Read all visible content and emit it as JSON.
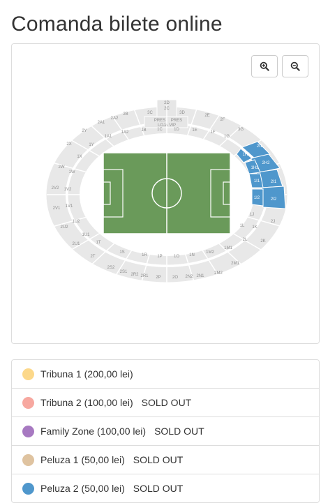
{
  "page": {
    "title": "Comanda bilete online"
  },
  "map": {
    "zoom_in_icon": "zoom-in-icon",
    "zoom_out_icon": "zoom-out-icon",
    "sections_grey": [
      "2D",
      "2C",
      "3D",
      "2B",
      "3C",
      "2E",
      "2A2",
      "1C",
      "1D",
      "2F",
      "2A1",
      "1B",
      "1E",
      "3G",
      "2Y",
      "1A2",
      "1F",
      "1A1",
      "1G",
      "2X",
      "1Y",
      "1X",
      "2W",
      "1W",
      "2V2",
      "1V2",
      "2V1",
      "1V1",
      "1U2",
      "2U2",
      "1U1",
      "2U1",
      "1T",
      "2T",
      "1S",
      "1R",
      "1P",
      "1O",
      "1N",
      "1M2",
      "1M1",
      "2S2",
      "2S1",
      "2R2",
      "2R1",
      "2P",
      "2O",
      "2N2",
      "2N1",
      "2M2",
      "2M1",
      "2L",
      "1L",
      "2K",
      "1K",
      "2J",
      "1J"
    ],
    "sections_blue": [
      "2I1",
      "1H1",
      "2H2",
      "1H2",
      "2I2",
      "1I1",
      "1I2"
    ],
    "press_labels": [
      "PRES",
      "PRES",
      "LOJA VIP"
    ]
  },
  "legend": [
    {
      "color": "#fcd88a",
      "label": "Tribuna 1",
      "price": "(200,00 lei)",
      "status": ""
    },
    {
      "color": "#f7a8a0",
      "label": "Tribuna 2",
      "price": "(100,00 lei)",
      "status": "SOLD OUT"
    },
    {
      "color": "#a779c1",
      "label": "Family Zone",
      "price": "(100,00 lei)",
      "status": "SOLD OUT"
    },
    {
      "color": "#dfc3a0",
      "label": "Peluza 1",
      "price": "(50,00 lei)",
      "status": "SOLD OUT"
    },
    {
      "color": "#4f97cc",
      "label": "Peluza 2",
      "price": "(50,00 lei)",
      "status": "SOLD OUT"
    }
  ]
}
